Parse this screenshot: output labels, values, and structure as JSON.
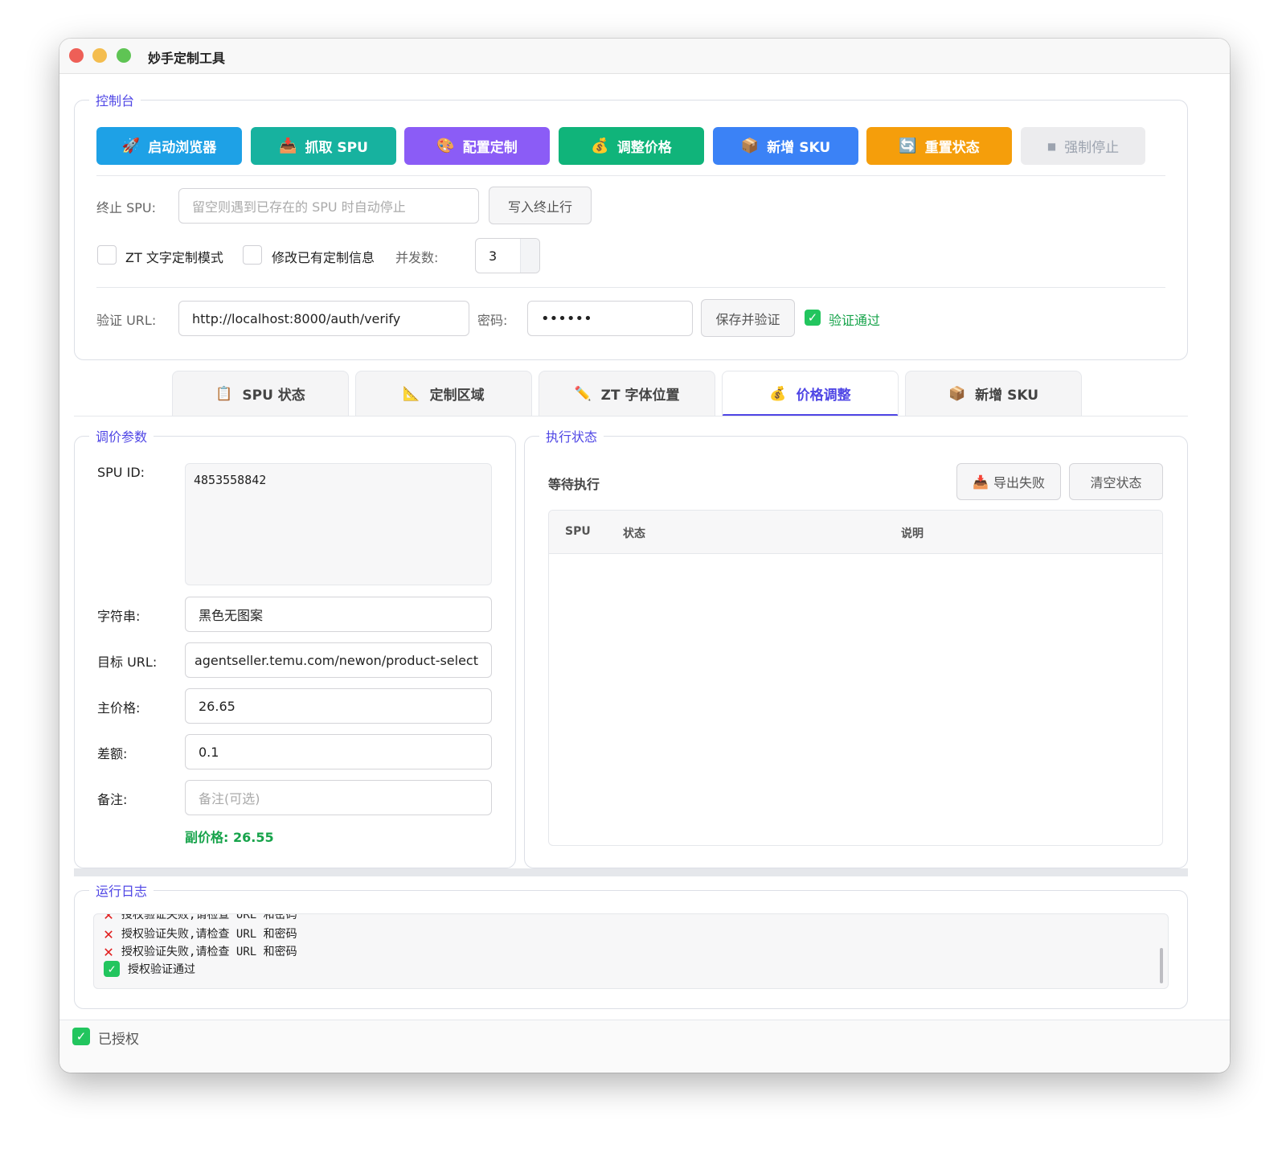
{
  "window": {
    "title": "妙手定制工具"
  },
  "console": {
    "title": "控制台",
    "toolbar": [
      {
        "label": "启动浏览器",
        "icon": "🚀",
        "color": "#1ea1e6"
      },
      {
        "label": "抓取 SPU",
        "icon": "📥",
        "color": "#17b29f"
      },
      {
        "label": "配置定制",
        "icon": "🎨",
        "color": "#8b5cf6"
      },
      {
        "label": "调整价格",
        "icon": "💰",
        "color": "#10b47a"
      },
      {
        "label": "新增 SKU",
        "icon": "📦",
        "color": "#3b82f6"
      },
      {
        "label": "重置状态",
        "icon": "🔄",
        "color": "#f59e0b"
      },
      {
        "label": "强制停止",
        "icon": "■",
        "color": "#ececee"
      }
    ],
    "stop_spu_label": "终止 SPU:",
    "stop_spu_placeholder": "留空则遇到已存在的 SPU 时自动停止",
    "write_stop_button": "写入终止行",
    "zt_mode_label": "ZT 文字定制模式",
    "modify_existing_label": "修改已有定制信息",
    "concurrency_label": "并发数:",
    "concurrency_value": "3",
    "verify_url_label": "验证 URL:",
    "verify_url_value": "http://localhost:8000/auth/verify",
    "password_label": "密码:",
    "password_value": "••••••",
    "save_verify_button": "保存并验证",
    "verify_status": "验证通过",
    "verify_status_color": "#16a34a"
  },
  "tabs": [
    {
      "label": "SPU 状态",
      "icon": "📋"
    },
    {
      "label": "定制区域",
      "icon": "📐"
    },
    {
      "label": "ZT 字体位置",
      "icon": "✏️"
    },
    {
      "label": "价格调整",
      "icon": "💰",
      "active": true
    },
    {
      "label": "新增 SKU",
      "icon": "📦"
    }
  ],
  "price_params": {
    "title": "调价参数",
    "spu_id_label": "SPU ID:",
    "spu_id_value": "4853558842",
    "string_label": "字符串:",
    "string_value": "黑色无图案",
    "target_url_label": "目标 URL:",
    "target_url_value": "agentseller.temu.com/newon/product-select",
    "main_price_label": "主价格:",
    "main_price_value": "26.65",
    "diff_label": "差额:",
    "diff_value": "0.1",
    "note_label": "备注:",
    "note_placeholder": "备注(可选)",
    "sub_price_text": "副价格: 26.55",
    "sub_price_color": "#16a34a"
  },
  "exec_status": {
    "title": "执行状态",
    "status_text": "等待执行",
    "export_failed_button": "导出失败",
    "export_icon": "📥",
    "clear_status_button": "清空状态",
    "table_headers": [
      "SPU",
      "状态",
      "说明"
    ],
    "rows": []
  },
  "run_log": {
    "title": "运行日志",
    "lines": [
      {
        "icon": "cross",
        "text": "授权验证失败,请检查 URL 和密码"
      },
      {
        "icon": "cross",
        "text": "授权验证失败,请检查 URL 和密码"
      },
      {
        "icon": "cross",
        "text": "授权验证失败,请检查 URL 和密码"
      },
      {
        "icon": "check",
        "text": "授权验证通过"
      }
    ]
  },
  "statusbar": {
    "text": "已授权"
  }
}
